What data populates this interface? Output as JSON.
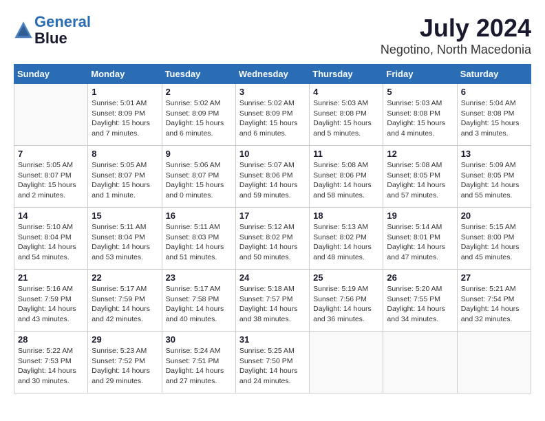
{
  "logo": {
    "line1": "General",
    "line2": "Blue"
  },
  "title": "July 2024",
  "location": "Negotino, North Macedonia",
  "days_of_week": [
    "Sunday",
    "Monday",
    "Tuesday",
    "Wednesday",
    "Thursday",
    "Friday",
    "Saturday"
  ],
  "weeks": [
    [
      {
        "day": "",
        "info": ""
      },
      {
        "day": "1",
        "info": "Sunrise: 5:01 AM\nSunset: 8:09 PM\nDaylight: 15 hours\nand 7 minutes."
      },
      {
        "day": "2",
        "info": "Sunrise: 5:02 AM\nSunset: 8:09 PM\nDaylight: 15 hours\nand 6 minutes."
      },
      {
        "day": "3",
        "info": "Sunrise: 5:02 AM\nSunset: 8:09 PM\nDaylight: 15 hours\nand 6 minutes."
      },
      {
        "day": "4",
        "info": "Sunrise: 5:03 AM\nSunset: 8:08 PM\nDaylight: 15 hours\nand 5 minutes."
      },
      {
        "day": "5",
        "info": "Sunrise: 5:03 AM\nSunset: 8:08 PM\nDaylight: 15 hours\nand 4 minutes."
      },
      {
        "day": "6",
        "info": "Sunrise: 5:04 AM\nSunset: 8:08 PM\nDaylight: 15 hours\nand 3 minutes."
      }
    ],
    [
      {
        "day": "7",
        "info": "Sunrise: 5:05 AM\nSunset: 8:07 PM\nDaylight: 15 hours\nand 2 minutes."
      },
      {
        "day": "8",
        "info": "Sunrise: 5:05 AM\nSunset: 8:07 PM\nDaylight: 15 hours\nand 1 minute."
      },
      {
        "day": "9",
        "info": "Sunrise: 5:06 AM\nSunset: 8:07 PM\nDaylight: 15 hours\nand 0 minutes."
      },
      {
        "day": "10",
        "info": "Sunrise: 5:07 AM\nSunset: 8:06 PM\nDaylight: 14 hours\nand 59 minutes."
      },
      {
        "day": "11",
        "info": "Sunrise: 5:08 AM\nSunset: 8:06 PM\nDaylight: 14 hours\nand 58 minutes."
      },
      {
        "day": "12",
        "info": "Sunrise: 5:08 AM\nSunset: 8:05 PM\nDaylight: 14 hours\nand 57 minutes."
      },
      {
        "day": "13",
        "info": "Sunrise: 5:09 AM\nSunset: 8:05 PM\nDaylight: 14 hours\nand 55 minutes."
      }
    ],
    [
      {
        "day": "14",
        "info": "Sunrise: 5:10 AM\nSunset: 8:04 PM\nDaylight: 14 hours\nand 54 minutes."
      },
      {
        "day": "15",
        "info": "Sunrise: 5:11 AM\nSunset: 8:04 PM\nDaylight: 14 hours\nand 53 minutes."
      },
      {
        "day": "16",
        "info": "Sunrise: 5:11 AM\nSunset: 8:03 PM\nDaylight: 14 hours\nand 51 minutes."
      },
      {
        "day": "17",
        "info": "Sunrise: 5:12 AM\nSunset: 8:02 PM\nDaylight: 14 hours\nand 50 minutes."
      },
      {
        "day": "18",
        "info": "Sunrise: 5:13 AM\nSunset: 8:02 PM\nDaylight: 14 hours\nand 48 minutes."
      },
      {
        "day": "19",
        "info": "Sunrise: 5:14 AM\nSunset: 8:01 PM\nDaylight: 14 hours\nand 47 minutes."
      },
      {
        "day": "20",
        "info": "Sunrise: 5:15 AM\nSunset: 8:00 PM\nDaylight: 14 hours\nand 45 minutes."
      }
    ],
    [
      {
        "day": "21",
        "info": "Sunrise: 5:16 AM\nSunset: 7:59 PM\nDaylight: 14 hours\nand 43 minutes."
      },
      {
        "day": "22",
        "info": "Sunrise: 5:17 AM\nSunset: 7:59 PM\nDaylight: 14 hours\nand 42 minutes."
      },
      {
        "day": "23",
        "info": "Sunrise: 5:17 AM\nSunset: 7:58 PM\nDaylight: 14 hours\nand 40 minutes."
      },
      {
        "day": "24",
        "info": "Sunrise: 5:18 AM\nSunset: 7:57 PM\nDaylight: 14 hours\nand 38 minutes."
      },
      {
        "day": "25",
        "info": "Sunrise: 5:19 AM\nSunset: 7:56 PM\nDaylight: 14 hours\nand 36 minutes."
      },
      {
        "day": "26",
        "info": "Sunrise: 5:20 AM\nSunset: 7:55 PM\nDaylight: 14 hours\nand 34 minutes."
      },
      {
        "day": "27",
        "info": "Sunrise: 5:21 AM\nSunset: 7:54 PM\nDaylight: 14 hours\nand 32 minutes."
      }
    ],
    [
      {
        "day": "28",
        "info": "Sunrise: 5:22 AM\nSunset: 7:53 PM\nDaylight: 14 hours\nand 30 minutes."
      },
      {
        "day": "29",
        "info": "Sunrise: 5:23 AM\nSunset: 7:52 PM\nDaylight: 14 hours\nand 29 minutes."
      },
      {
        "day": "30",
        "info": "Sunrise: 5:24 AM\nSunset: 7:51 PM\nDaylight: 14 hours\nand 27 minutes."
      },
      {
        "day": "31",
        "info": "Sunrise: 5:25 AM\nSunset: 7:50 PM\nDaylight: 14 hours\nand 24 minutes."
      },
      {
        "day": "",
        "info": ""
      },
      {
        "day": "",
        "info": ""
      },
      {
        "day": "",
        "info": ""
      }
    ]
  ]
}
